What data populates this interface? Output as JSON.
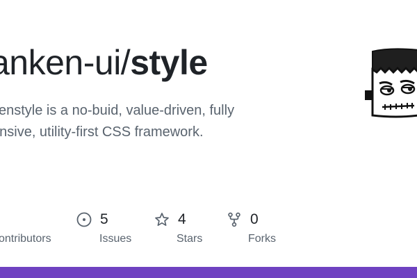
{
  "repo": {
    "owner_prefix": "anken-ui/",
    "name": "style",
    "description_line1": "kenstyle is a no-buid, value-driven, fully",
    "description_line2": "onsive, utility-first CSS framework."
  },
  "stats": [
    {
      "icon": "people-icon",
      "count": "",
      "label": "ontributors"
    },
    {
      "icon": "issue-icon",
      "count": "5",
      "label": "Issues"
    },
    {
      "icon": "star-icon",
      "count": "4",
      "label": "Stars"
    },
    {
      "icon": "fork-icon",
      "count": "0",
      "label": "Forks"
    }
  ],
  "avatar": {
    "icon": "frankenstein-monster-icon"
  },
  "colors": {
    "bottom_bar": "#6f42c1",
    "text_primary": "#1f2328",
    "text_muted": "#59636e"
  }
}
